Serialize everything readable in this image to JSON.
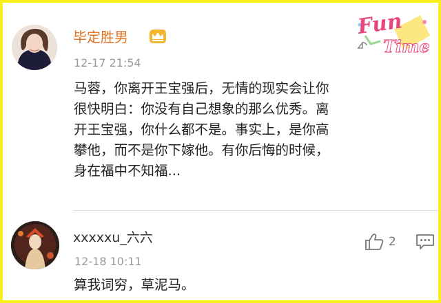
{
  "comments": [
    {
      "username": "毕定胜男",
      "badge_icon": "crown-icon",
      "time": "12-17 21:54",
      "lines": [
        "马蓉，你离开王宝强后，无情的现实会让你",
        "很快明白：你没有自己想象的那么优秀。离",
        "开王宝强，你什么都不是。事实上，是你高",
        "攀他，而不是你下嫁他。有你后悔的时候，",
        "身在福中不知福..."
      ]
    },
    {
      "username": "xxxxxu_六六",
      "time": "12-18 10:11",
      "likes": "2",
      "lines": [
        "算我词穷，草泥马。"
      ]
    }
  ],
  "logo": {
    "word1": "Fun",
    "word2": "Time"
  },
  "colors": {
    "border": "#f7ee1c",
    "vip_name": "#e0701e",
    "meta": "#999999"
  }
}
